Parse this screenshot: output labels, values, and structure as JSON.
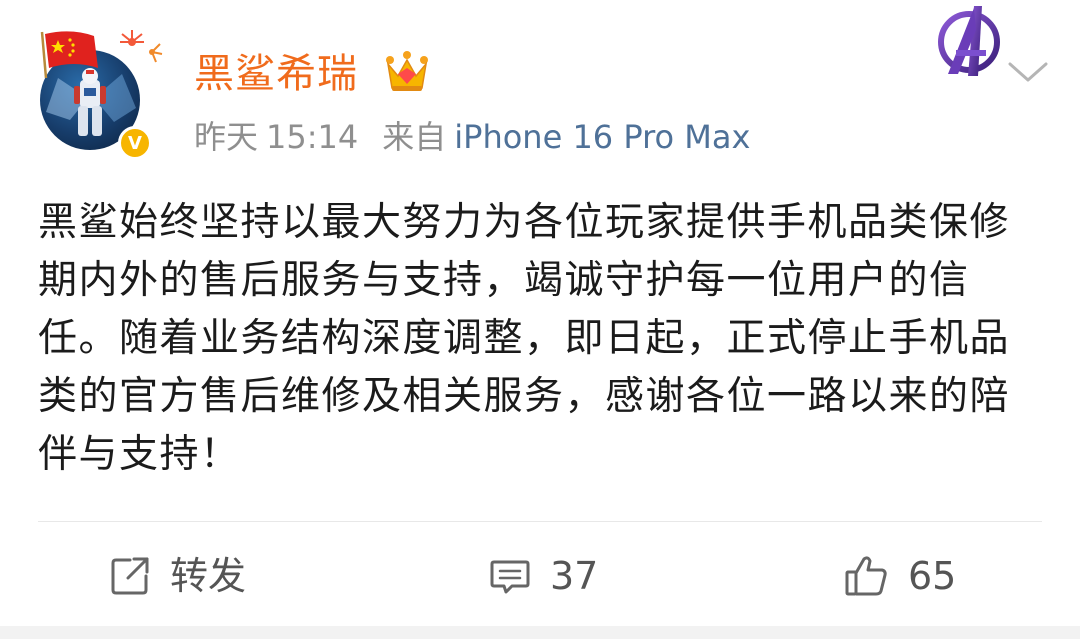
{
  "post": {
    "author": {
      "name": "黑鲨希瑞",
      "verified_badge": "V",
      "avatar_icon": "avatar-mecha-robot",
      "flag_icon": "china-flag-icon",
      "crown_icon": "vip-crown-icon"
    },
    "meta": {
      "date_label": "昨天",
      "time": "15:14",
      "source_prefix": "来自",
      "device": "iPhone 16 Pro Max"
    },
    "text": "黑鲨始终坚持以最大努力为各位玩家提供手机品类保修期内外的售后服务与支持，竭诚守护每一位用户的信任。随着业务结构深度调整，即日起，正式停止手机品类的官方售后维修及相关服务，感谢各位一路以来的陪伴与支持！"
  },
  "header_right": {
    "emblem_icon": "avengers-emblem-icon",
    "menu_icon": "chevron-down-icon"
  },
  "actions": {
    "repost": {
      "label": "转发",
      "icon": "share-icon"
    },
    "comment": {
      "label": "37",
      "icon": "comment-icon"
    },
    "like": {
      "label": "65",
      "icon": "thumbs-up-icon"
    }
  },
  "colors": {
    "username": "#f06b1c",
    "device_link": "#4f7198",
    "meta_gray": "#8f8f8f",
    "verified": "#f7b500"
  }
}
